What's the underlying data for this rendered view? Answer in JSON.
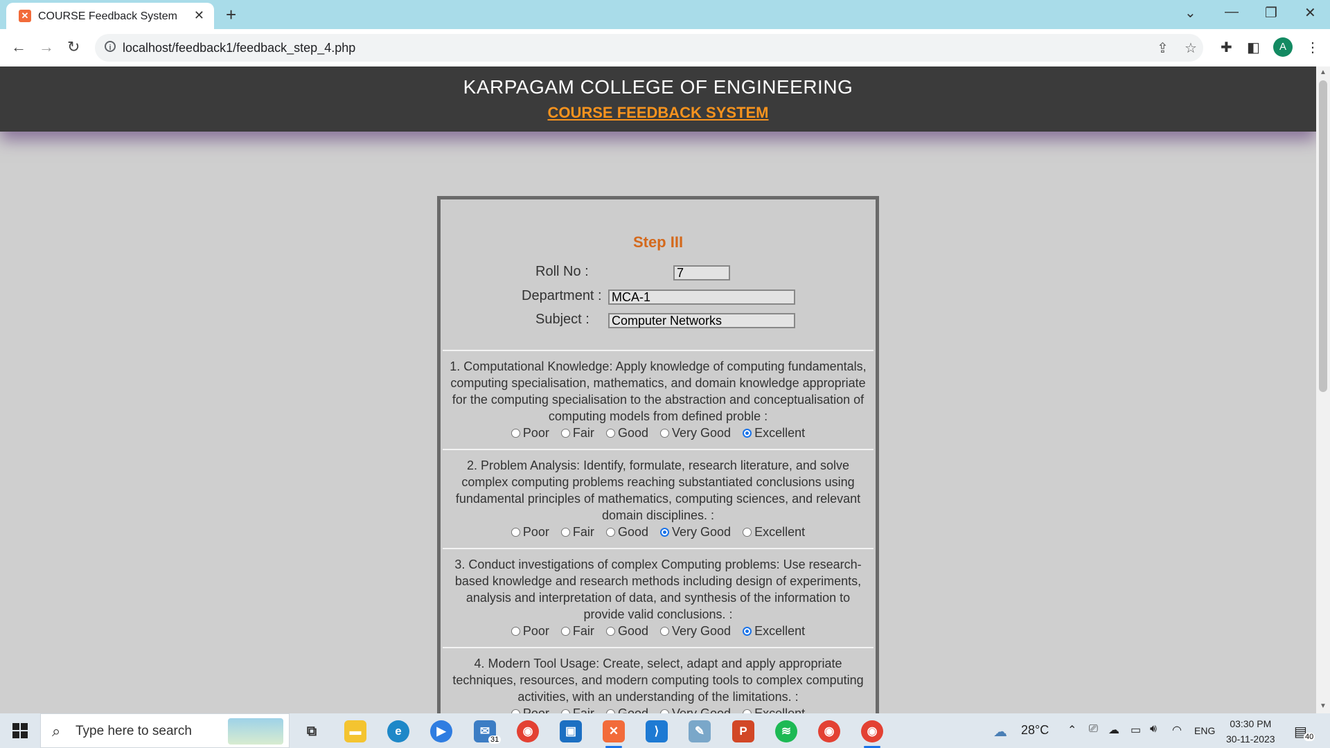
{
  "browser": {
    "tab_title": "COURSE Feedback System",
    "tab_icon": "xampp-icon",
    "url": "localhost/feedback1/feedback_step_4.php",
    "avatar_letter": "A"
  },
  "header": {
    "college": "KARPAGAM COLLEGE OF ENGINEERING",
    "system": "COURSE FEEDBACK SYSTEM"
  },
  "form": {
    "step": "Step III",
    "roll_label": "Roll No :",
    "roll_value": "7",
    "dept_label": "Department :",
    "dept_value": "MCA-1",
    "subject_label": "Subject :",
    "subject_value": "Computer Networks",
    "options": [
      "Poor",
      "Fair",
      "Good",
      "Very Good",
      "Excellent"
    ],
    "questions": [
      {
        "text": "1. Computational Knowledge: Apply knowledge of computing fundamentals, computing specialisation, mathematics, and domain knowledge appropriate for the computing specialisation to the abstraction and conceptualisation of computing models from defined proble :",
        "selected": "Excellent"
      },
      {
        "text": "2. Problem Analysis: Identify, formulate, research literature, and solve complex computing problems reaching substantiated conclusions using fundamental principles of mathematics, computing sciences, and relevant domain disciplines. :",
        "selected": "Very Good"
      },
      {
        "text": "3. Conduct investigations of complex Computing problems: Use research-based knowledge and research methods including design of experiments, analysis and interpretation of data, and synthesis of the information to provide valid conclusions. :",
        "selected": "Excellent"
      },
      {
        "text": "4. Modern Tool Usage: Create, select, adapt and apply appropriate techniques, resources, and modern computing tools to complex computing activities, with an understanding of the limitations. :",
        "selected": ""
      }
    ]
  },
  "taskbar": {
    "search_placeholder": "Type here to search",
    "mail_badge": "31",
    "weather": "28°C",
    "language": "ENG",
    "time": "03:30 PM",
    "date": "30-11-2023",
    "notification_count": "40"
  }
}
